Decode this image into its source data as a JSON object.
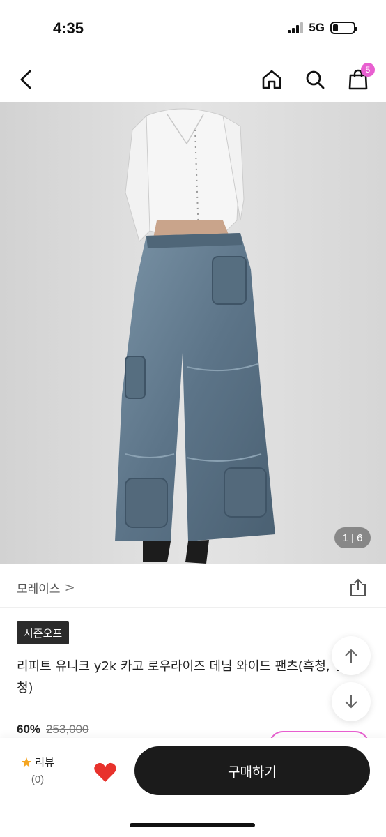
{
  "status_bar": {
    "time": "4:35",
    "network": "5G",
    "battery_fraction": 0.25
  },
  "header": {
    "cart_count": "5"
  },
  "gallery": {
    "counter": "1 | 6",
    "icons": [
      "chevron-left-icon",
      "home-icon",
      "search-icon",
      "shopping-bag-icon"
    ]
  },
  "brand": {
    "name": "모레이스",
    "chevron": ">"
  },
  "product": {
    "season_badge": "시즌오프",
    "title": "리피트 유니크 y2k 카고 로우라이즈 데님 와이드 팬츠(흑청, 연청)"
  },
  "price": {
    "discount": "60%",
    "original": "253,000"
  },
  "bottom_bar": {
    "review_label": "리뷰",
    "review_count": "(0)",
    "buy_label": "구매하기"
  },
  "colors": {
    "accent_pink": "#e85fd0",
    "heart_red": "#e8322c",
    "star_orange": "#f5a623",
    "buy_button": "#1b1b1b"
  }
}
